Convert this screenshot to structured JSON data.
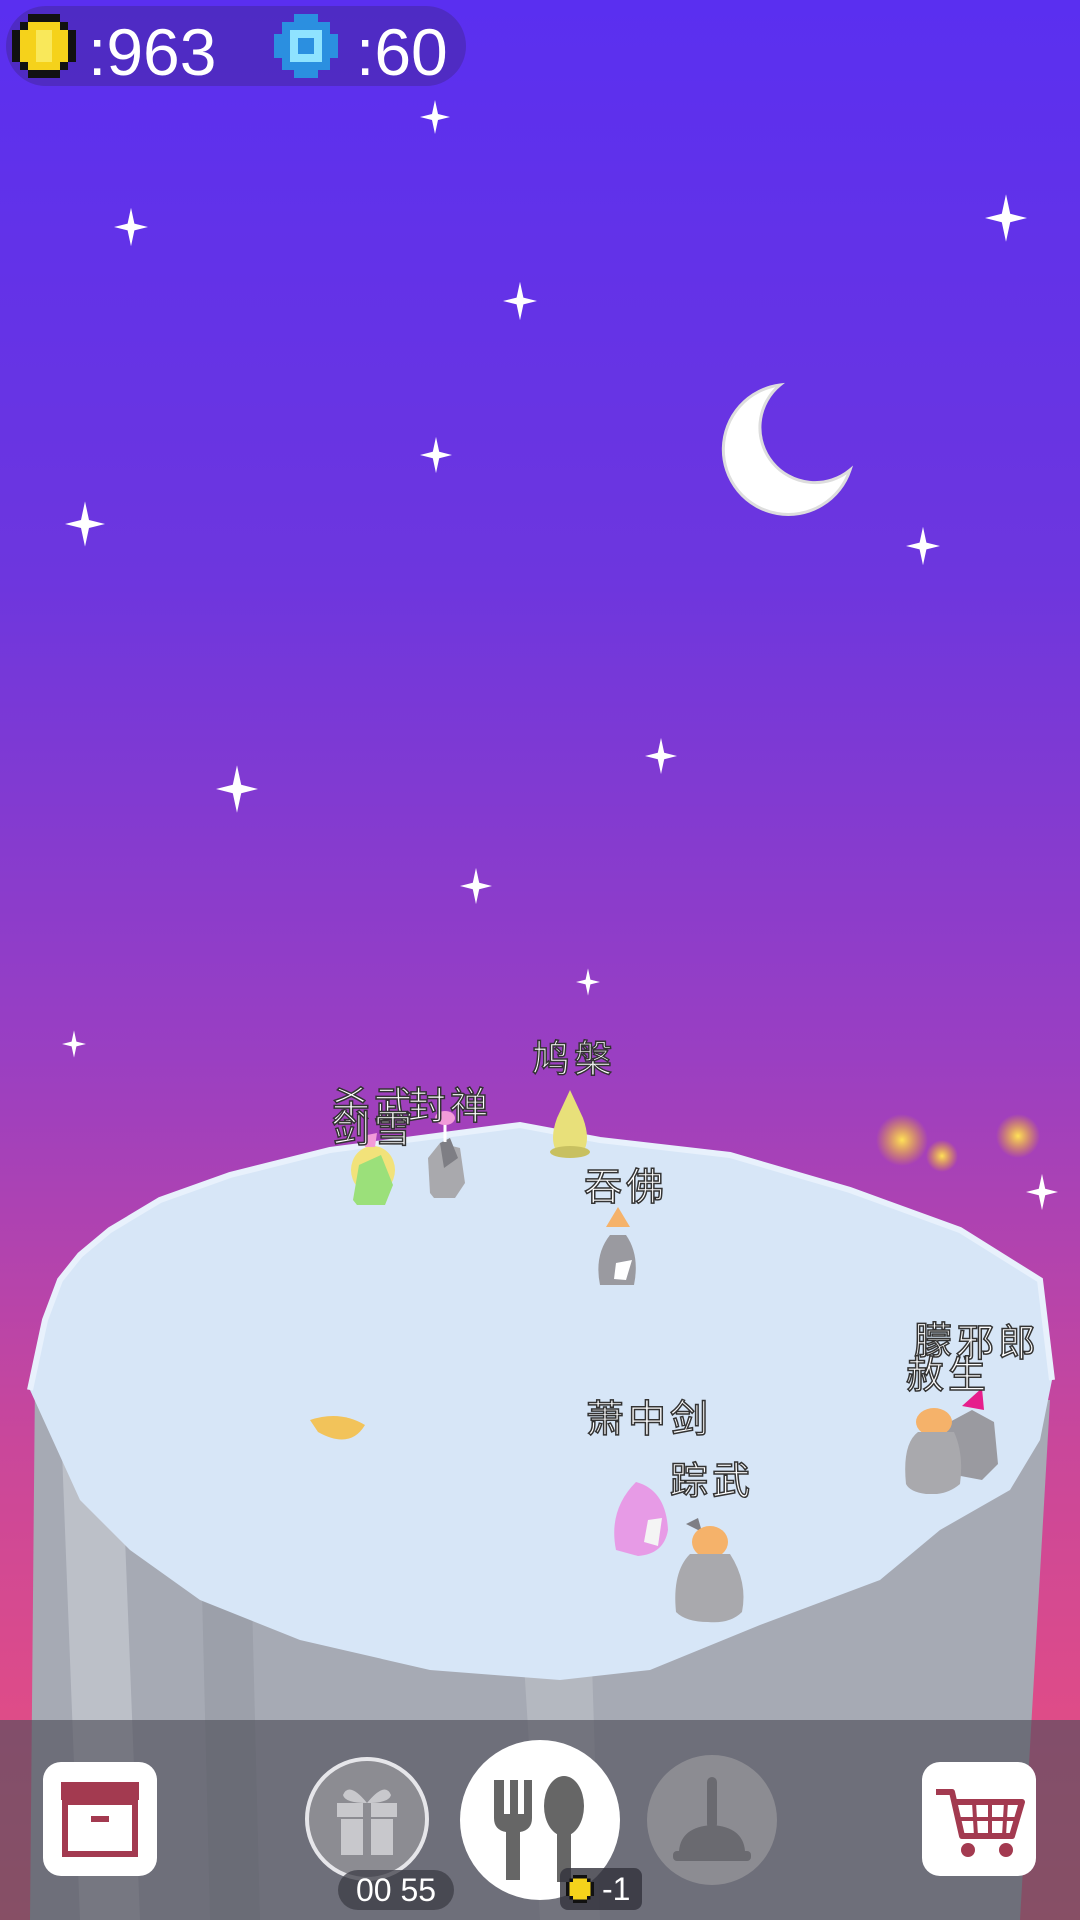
{
  "hud": {
    "coins": ":963",
    "gems": ":60",
    "coin_color": "#f5d21b",
    "gem_color": "#3aa9f0"
  },
  "characters": [
    {
      "name": "杀武",
      "color": "#9be07a"
    },
    {
      "name": "剑雪",
      "color": "#f2e27a"
    },
    {
      "name": "封禅",
      "color": "#a9a9ad"
    },
    {
      "name": "鸠槃",
      "color": "#e8e07a"
    },
    {
      "name": "吞佛",
      "color": "#9a9aa0"
    },
    {
      "name": "萧中剑",
      "color": "#e79be6"
    },
    {
      "name": "踪武",
      "color": "#a9a9ad"
    },
    {
      "name": "朦",
      "color": "#a9a9ad"
    },
    {
      "name": "邪郎",
      "color": "#a9a9ad"
    },
    {
      "name": "赦生",
      "color": "#f5b26a"
    }
  ],
  "toolbar": {
    "timer": "00 55",
    "feed_cost": "-1",
    "inventory_icon": "box-icon",
    "gift_icon": "gift-icon",
    "feed_icon": "fork-spoon-icon",
    "clean_icon": "plunger-icon",
    "shop_icon": "cart-icon"
  }
}
